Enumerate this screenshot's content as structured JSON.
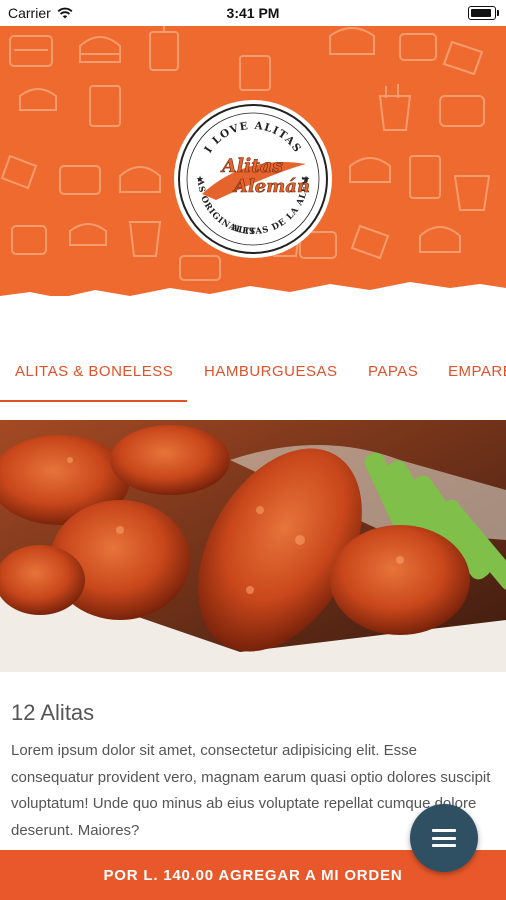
{
  "status_bar": {
    "carrier": "Carrier",
    "time": "3:41 PM"
  },
  "logo": {
    "ring_top": "I LOVE ALITAS",
    "ring_bottom_left": "LAS ORIGINALES",
    "ring_bottom_right": "ALITAS DE LA ALEMÁN",
    "brand_line1": "Alitas",
    "brand_line2": "Alemán"
  },
  "tabs": [
    {
      "label": "ALITAS & BONELESS",
      "active": true
    },
    {
      "label": "HAMBURGUESAS"
    },
    {
      "label": "PAPAS"
    },
    {
      "label": "EMPARE"
    }
  ],
  "product": {
    "title": "12 Alitas",
    "description": "Lorem ipsum dolor sit amet, consectetur adipisicing elit. Esse consequatur provident vero, magnam earum quasi optio dolores suscipit voluptatum! Unde quo minus ab eius voluptate repellat cumque dolore deserunt. Maiores?"
  },
  "order_button": {
    "label": "POR L. 140.00 AGREGAR A MI ORDEN"
  },
  "colors": {
    "brand_orange": "#ef6a2f",
    "accent": "#e0522a",
    "fab": "#2f4f63"
  },
  "icons": {
    "menu": "hamburger-menu-icon",
    "wifi": "wifi-icon",
    "battery": "battery-icon"
  }
}
